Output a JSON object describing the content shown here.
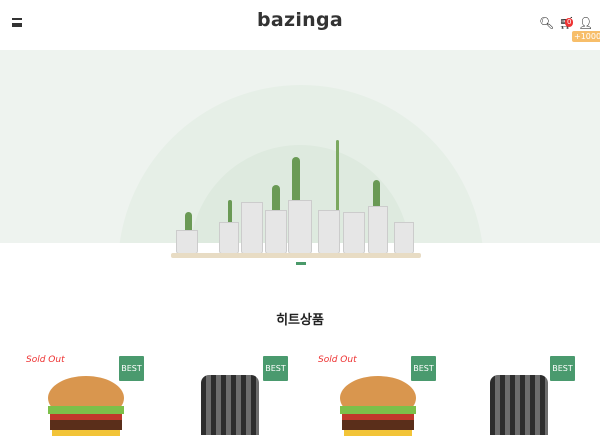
{
  "header": {
    "logo": "bazinga",
    "cart_count": "0",
    "points": "+1000"
  },
  "section": {
    "title": "히트상품"
  },
  "products": [
    {
      "sold_out": "Sold Out",
      "badge": "BEST",
      "image": "burger"
    },
    {
      "sold_out": "",
      "badge": "BEST",
      "image": "plaid-shirt"
    },
    {
      "sold_out": "Sold Out",
      "badge": "BEST",
      "image": "burger"
    },
    {
      "sold_out": "",
      "badge": "BEST",
      "image": "plaid-shirt"
    }
  ],
  "colors": {
    "badge": "#4a9a6e",
    "sold_out": "#e33333",
    "points": "#f7be6a"
  }
}
